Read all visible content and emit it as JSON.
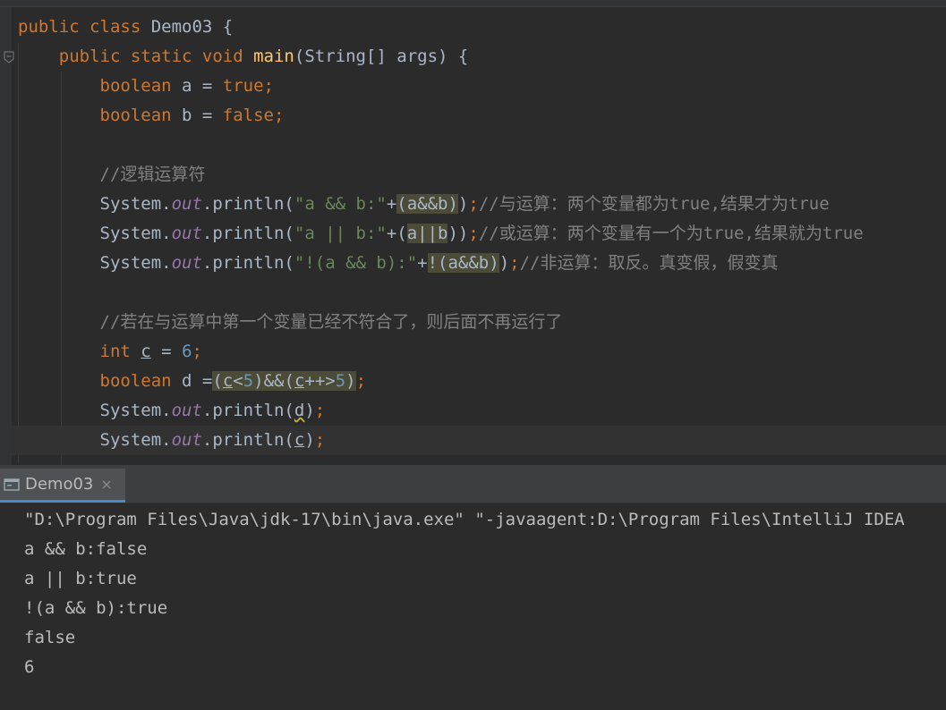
{
  "editor": {
    "lines": [
      [
        {
          "t": "public class ",
          "c": "kw"
        },
        {
          "t": "Demo03 {",
          "c": ""
        }
      ],
      [
        {
          "t": "    public static void ",
          "c": "kw"
        },
        {
          "t": "main",
          "c": "fn"
        },
        {
          "t": "(String[] args) {",
          "c": ""
        }
      ],
      [
        {
          "t": "        boolean ",
          "c": "kw"
        },
        {
          "t": "a = ",
          "c": ""
        },
        {
          "t": "true;",
          "c": "kw"
        }
      ],
      [
        {
          "t": "        boolean ",
          "c": "kw"
        },
        {
          "t": "b = ",
          "c": ""
        },
        {
          "t": "false;",
          "c": "kw"
        }
      ],
      [],
      [
        {
          "t": "        //逻辑运算符",
          "c": "cm"
        }
      ],
      [
        {
          "t": "        System.",
          "c": ""
        },
        {
          "t": "out",
          "c": "fld"
        },
        {
          "t": ".println(",
          "c": ""
        },
        {
          "t": "\"a && b:\"",
          "c": "str"
        },
        {
          "t": "+",
          "c": ""
        },
        {
          "t": "(a&&b)",
          "c": "hl"
        },
        {
          "t": ")",
          "c": ""
        },
        {
          "t": ";",
          "c": "kw"
        },
        {
          "t": "//与运算：两个变量都为true,结果才为true",
          "c": "cm"
        }
      ],
      [
        {
          "t": "        System.",
          "c": ""
        },
        {
          "t": "out",
          "c": "fld"
        },
        {
          "t": ".println(",
          "c": ""
        },
        {
          "t": "\"a || b:\"",
          "c": "str"
        },
        {
          "t": "+(",
          "c": ""
        },
        {
          "t": "a||b",
          "c": "hl"
        },
        {
          "t": "))",
          "c": ""
        },
        {
          "t": ";",
          "c": "kw"
        },
        {
          "t": "//或运算：两个变量有一个为true,结果就为true",
          "c": "cm"
        }
      ],
      [
        {
          "t": "        System.",
          "c": ""
        },
        {
          "t": "out",
          "c": "fld"
        },
        {
          "t": ".println(",
          "c": ""
        },
        {
          "t": "\"!(a && b):\"",
          "c": "str"
        },
        {
          "t": "+",
          "c": ""
        },
        {
          "t": "!(a&&b)",
          "c": "hl"
        },
        {
          "t": ")",
          "c": ""
        },
        {
          "t": ";",
          "c": "kw"
        },
        {
          "t": "//非运算：取反。真变假，假变真",
          "c": "cm"
        }
      ],
      [],
      [
        {
          "t": "        //若在与运算中第一个变量已经不符合了，则后面不再运行了",
          "c": "cm"
        }
      ],
      [
        {
          "t": "        int ",
          "c": "kw"
        },
        {
          "t": "c",
          "c": "ul"
        },
        {
          "t": " = ",
          "c": ""
        },
        {
          "t": "6",
          "c": "num"
        },
        {
          "t": ";",
          "c": "kw"
        }
      ],
      [
        {
          "t": "        boolean ",
          "c": "kw"
        },
        {
          "t": "d =",
          "c": ""
        },
        {
          "t": "(",
          "c": "hl"
        },
        {
          "t": "c",
          "c": "hl ul"
        },
        {
          "t": "<",
          "c": "hl"
        },
        {
          "t": "5",
          "c": "hl num"
        },
        {
          "t": ")&&(",
          "c": "hl"
        },
        {
          "t": "c",
          "c": "hl ul"
        },
        {
          "t": "++>",
          "c": "hl"
        },
        {
          "t": "5",
          "c": "hl num"
        },
        {
          "t": ")",
          "c": "hl"
        },
        {
          "t": ";",
          "c": "kw"
        }
      ],
      [
        {
          "t": "        System.",
          "c": ""
        },
        {
          "t": "out",
          "c": "fld"
        },
        {
          "t": ".println(",
          "c": ""
        },
        {
          "t": "d",
          "c": "squig"
        },
        {
          "t": ")",
          "c": ""
        },
        {
          "t": ";",
          "c": "kw"
        }
      ],
      [
        {
          "t": "        System.",
          "c": ""
        },
        {
          "t": "out",
          "c": "fld"
        },
        {
          "t": ".println(",
          "c": ""
        },
        {
          "t": "c",
          "c": "ul"
        },
        {
          "t": ")",
          "c": ""
        },
        {
          "t": ";",
          "c": "kw"
        }
      ]
    ]
  },
  "run": {
    "tab_label": "Demo03",
    "close_glyph": "×",
    "output": [
      "\"D:\\Program Files\\Java\\jdk-17\\bin\\java.exe\" \"-javaagent:D:\\Program Files\\IntelliJ IDEA",
      "a && b:false",
      "a || b:true",
      "!(a && b):true",
      "false",
      "6"
    ]
  },
  "colors": {
    "keyword": "#cc7832",
    "string": "#6a8759",
    "number": "#6897bb",
    "field": "#9876aa",
    "method": "#ffc66d",
    "comment": "#808080",
    "plain": "#a9b7c6",
    "highlight": "#4b4b37",
    "tab_underline": "#4a88c7"
  },
  "icons": [
    "fold-marker-icon",
    "console-icon",
    "close-icon"
  ]
}
